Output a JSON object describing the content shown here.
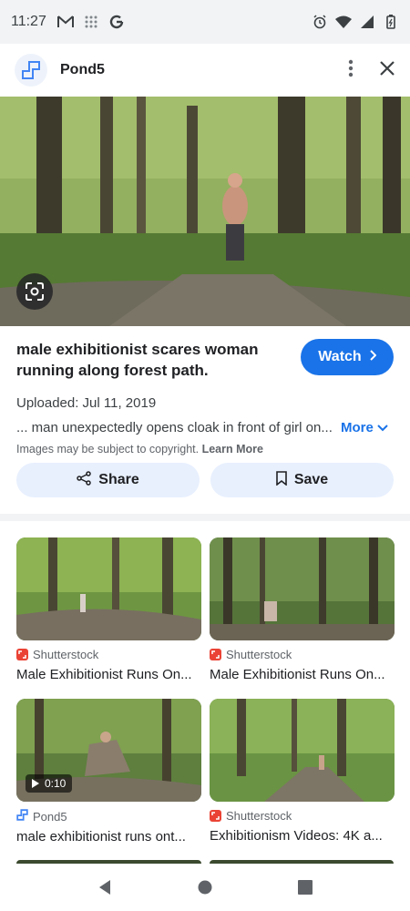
{
  "status_bar": {
    "time": "11:27",
    "left_icons": [
      "gmail-icon",
      "grid-dots-icon",
      "google-g-icon"
    ],
    "right_icons": [
      "alarm-icon",
      "wifi-icon",
      "signal-icon",
      "battery-icon"
    ]
  },
  "header": {
    "site_name": "Pond5",
    "logo_icon": "pond5-logo-icon",
    "actions": [
      "more-vert-icon",
      "close-icon"
    ]
  },
  "hero": {
    "lens_icon": "google-lens-icon"
  },
  "result": {
    "title": "male exhibitionist scares woman running along forest path.",
    "watch_label": "Watch",
    "upload_date": "Uploaded: Jul 11, 2019",
    "description": "... man unexpectedly opens cloak in front of girl on...",
    "more_label": "More",
    "copyright_text": "Images may be subject to copyright.",
    "learn_more_label": "Learn More"
  },
  "actions": {
    "share_label": "Share",
    "save_label": "Save"
  },
  "related": [
    {
      "source": "Shutterstock",
      "title": "Male Exhibitionist Runs On...",
      "source_icon": "shutterstock-icon"
    },
    {
      "source": "Shutterstock",
      "title": "Male Exhibitionist Runs On...",
      "source_icon": "shutterstock-icon"
    },
    {
      "source": "Pond5",
      "title": "male exhibitionist runs ont...",
      "source_icon": "pond5-logo-icon",
      "duration": "0:10"
    },
    {
      "source": "Shutterstock",
      "title": "Exhibitionism Videos: 4K a...",
      "source_icon": "shutterstock-icon"
    }
  ],
  "colors": {
    "accent": "#1a73e8",
    "chip_bg": "#e8f0fe",
    "shutterstock_red": "#ea4335"
  }
}
